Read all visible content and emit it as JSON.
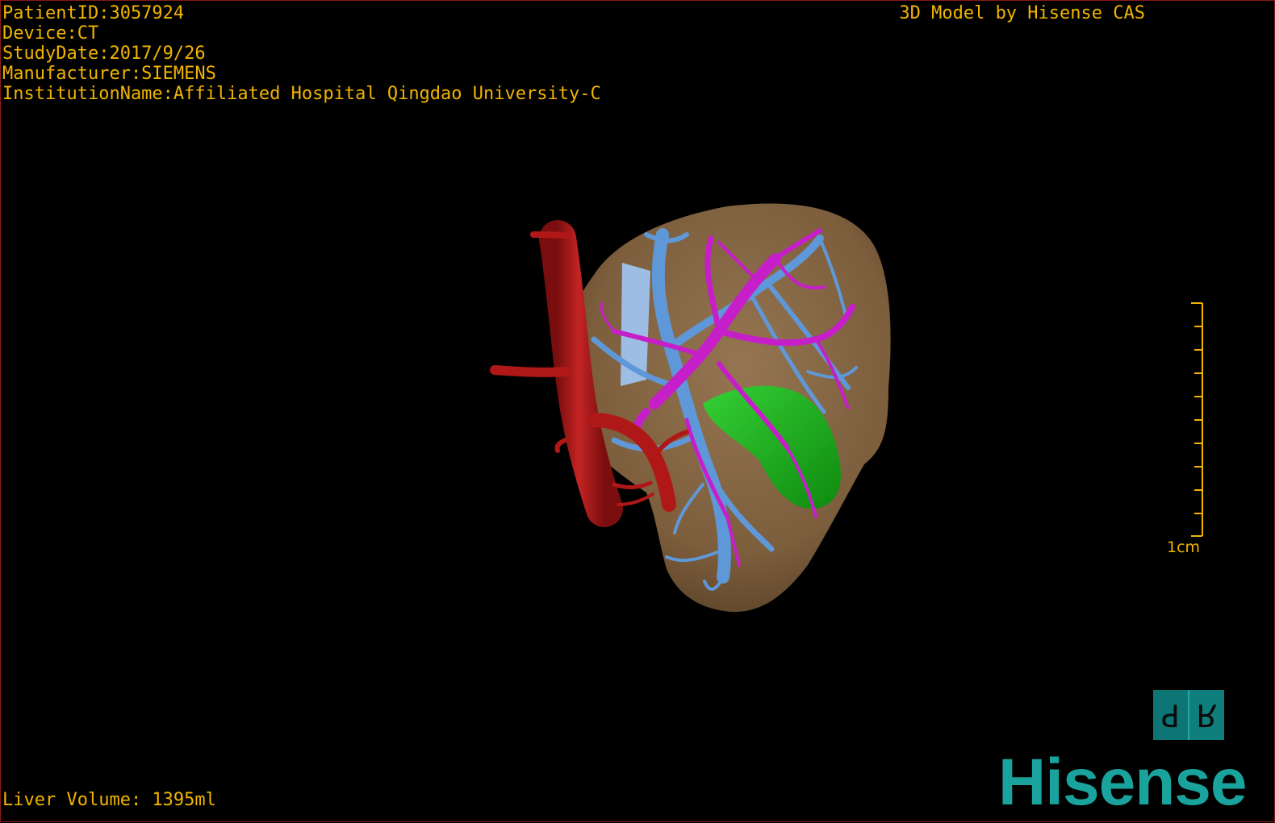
{
  "info": {
    "patient_id": "PatientID:3057924",
    "device": "Device:CT",
    "study_date": "StudyDate:2017/9/26",
    "manufacturer": "Manufacturer:SIEMENS",
    "institution": "InstitutionName:Affiliated Hospital Qingdao University-C"
  },
  "brand_caption": "3D Model by Hisense CAS",
  "liver_volume": "Liver Volume: 1395ml",
  "scale_bar": {
    "label": "1cm"
  },
  "orientation_cube": {
    "left_face": "P",
    "right_face": "R"
  },
  "logo": "Hisense",
  "colors": {
    "overlay_text": "#f1b400",
    "liver": "#8a6a48",
    "artery": "#b01818",
    "portal_vein": "#5c95d6",
    "hepatic_vein": "#c51ec8",
    "gallbladder": "#1fb31f",
    "logo": "#1aa39c",
    "cube": "#0f7f7e"
  }
}
